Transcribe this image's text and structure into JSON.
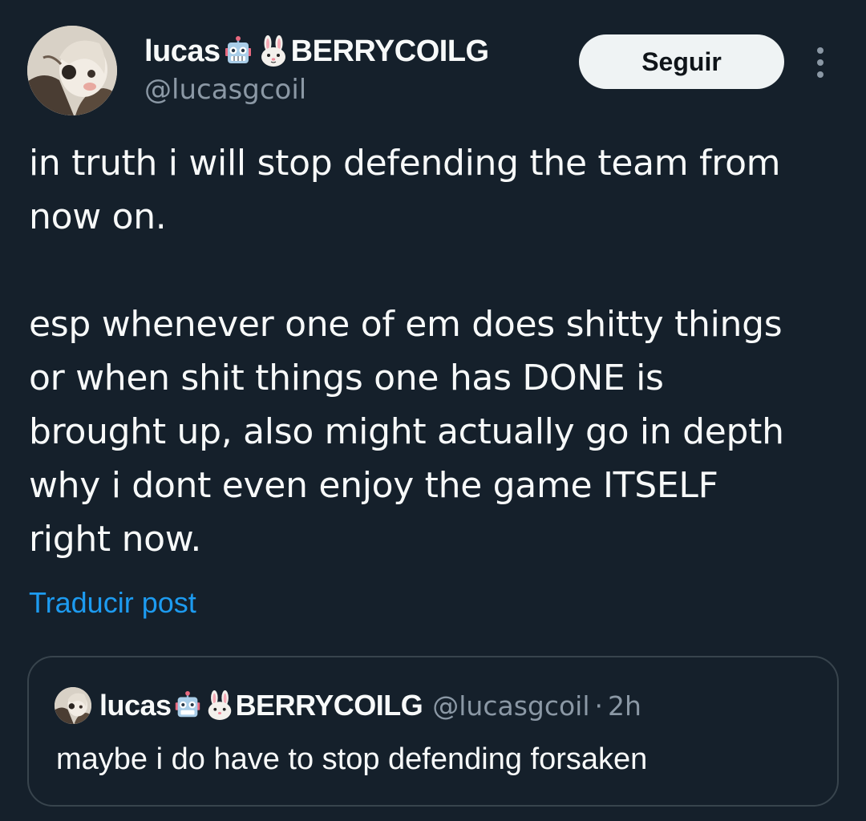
{
  "author": {
    "name_part1": "lucas",
    "name_part2": "BERRYCOILG",
    "emoji_icons": [
      "robot-face-icon",
      "rabbit-face-icon"
    ],
    "handle": "@lucasgcoil"
  },
  "actions": {
    "follow_label": "Seguir",
    "more_icon": "more-vertical-icon"
  },
  "post": {
    "paragraph1": [
      "in truth i will stop defending the team from",
      "now on."
    ],
    "paragraph2": [
      "esp whenever one of em does shitty things",
      "or when shit things one has DONE is",
      "brought up, also might actually go in depth",
      "why i dont even enjoy the game ITSELF",
      "right now."
    ],
    "translate_label": "Traducir post"
  },
  "quote": {
    "name_part1": "lucas",
    "name_part2": "BERRYCOILG",
    "handle": "@lucasgcoil",
    "separator": "·",
    "time": "2h",
    "text": "maybe i do have to stop defending forsaken"
  },
  "colors": {
    "background": "#15202b",
    "text": "#f7f9f9",
    "secondary_text": "#8b98a5",
    "link": "#1d9bf0",
    "border": "#38444d",
    "button_bg": "#eff3f4"
  }
}
